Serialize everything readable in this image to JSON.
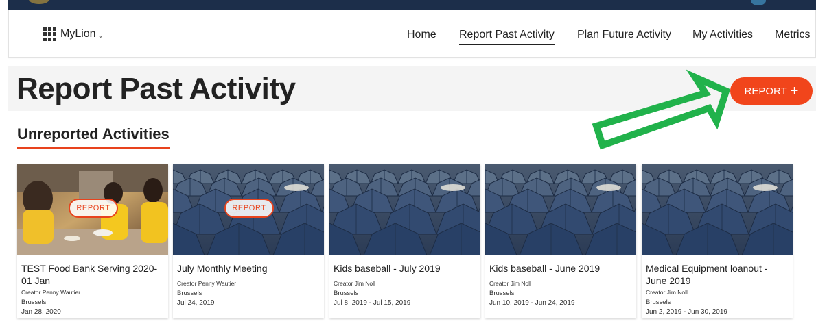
{
  "nav": {
    "brand": "MyLion",
    "caret": "⌵",
    "items": [
      {
        "label": "Home"
      },
      {
        "label": "Report Past Activity"
      },
      {
        "label": "Plan Future Activity"
      },
      {
        "label": "My Activities"
      },
      {
        "label": "Metrics"
      }
    ]
  },
  "page": {
    "title": "Report Past Activity",
    "report_button": "REPORT",
    "report_button_icon": "+",
    "section_title": "Unreported Activities"
  },
  "colors": {
    "accent": "#f1451b",
    "annotation_arrow": "#21b24b",
    "top_band": "#1c2e4a"
  },
  "cards": [
    {
      "title": "TEST Food Bank Serving 2020-01 Jan",
      "creator": "Creator Penny Wautier",
      "location": "Brussels",
      "date": "Jan 28, 2020",
      "badge": "REPORT",
      "image": "food-bank-photo"
    },
    {
      "title": "July Monthly Meeting",
      "creator": "Creator Penny Wautier",
      "location": "Brussels",
      "date": "Jul 24, 2019",
      "badge": "REPORT",
      "image": "tents-photo"
    },
    {
      "title": "Kids baseball - July 2019",
      "creator": "Creator Jim Noll",
      "location": "Brussels",
      "date": "Jul 8, 2019 - Jul 15, 2019",
      "image": "tents-photo"
    },
    {
      "title": "Kids baseball - June 2019",
      "creator": "Creator Jim Noll",
      "location": "Brussels",
      "date": "Jun 10, 2019 - Jun 24, 2019",
      "image": "tents-photo"
    },
    {
      "title": "Medical Equipment loanout - June 2019",
      "creator": "Creator Jim Noll",
      "location": "Brussels",
      "date": "Jun 2, 2019 - Jun 30, 2019",
      "image": "tents-photo"
    }
  ]
}
